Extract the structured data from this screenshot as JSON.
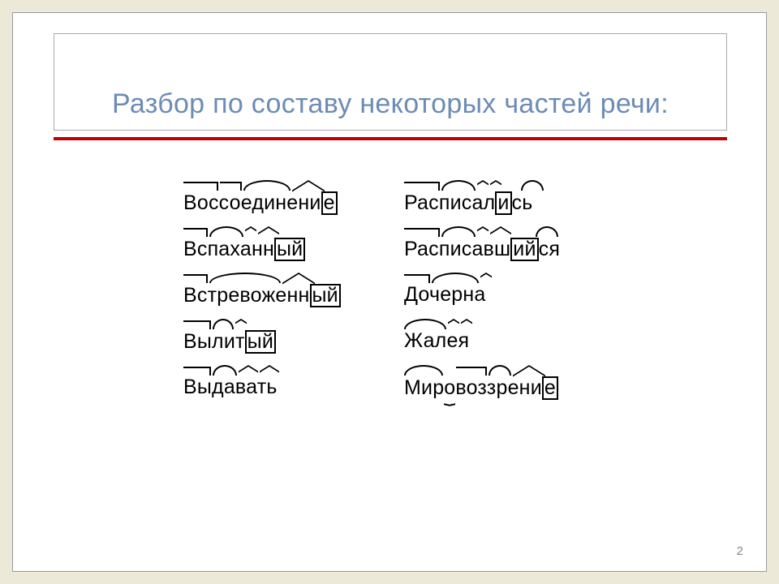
{
  "title": "Разбор по составу некоторых частей речи:",
  "page_number": "2",
  "words": [
    {
      "left": {
        "text": "Воссоединение",
        "morphemes": {
          "prefixes": [
            "Вос",
            "со"
          ],
          "roots": [
            "един"
          ],
          "suffixes": [
            "ени"
          ],
          "ending": "е"
        }
      },
      "right": {
        "text": "Расписались",
        "morphemes": {
          "prefixes": [
            "Рас"
          ],
          "roots": [
            "пис"
          ],
          "suffixes": [
            "а",
            "л"
          ],
          "ending": "и",
          "postfix": "сь"
        }
      }
    },
    {
      "left": {
        "text": "Вспаханный",
        "morphemes": {
          "prefixes": [
            "Вс"
          ],
          "roots": [
            "пах"
          ],
          "suffixes": [
            "а",
            "нн"
          ],
          "ending": "ый"
        }
      },
      "right": {
        "text": "Расписавшийся",
        "morphemes": {
          "prefixes": [
            "Рас"
          ],
          "roots": [
            "пис"
          ],
          "suffixes": [
            "а",
            "вш"
          ],
          "ending": "ий",
          "postfix": "ся"
        }
      }
    },
    {
      "left": {
        "text": "Встревоженный",
        "morphemes": {
          "prefixes": [
            "Вс"
          ],
          "roots": [
            "тревож"
          ],
          "suffixes": [
            "енн"
          ],
          "ending": "ый"
        }
      },
      "right": {
        "text": "Дочерна",
        "morphemes": {
          "prefixes": [
            "До"
          ],
          "roots": [
            "черн"
          ],
          "suffixes": [
            "а"
          ]
        }
      }
    },
    {
      "left": {
        "text": "Вылитый",
        "morphemes": {
          "prefixes": [
            "Вы"
          ],
          "roots": [
            "ли"
          ],
          "suffixes": [
            "т"
          ],
          "ending": "ый"
        }
      },
      "right": {
        "text": "Жалея",
        "morphemes": {
          "roots": [
            "Жал"
          ],
          "suffixes": [
            "е",
            "я"
          ]
        }
      }
    },
    {
      "left": {
        "text": "Выдавать",
        "morphemes": {
          "prefixes": [
            "Вы"
          ],
          "roots": [
            "да"
          ],
          "suffixes": [
            "ва",
            "ть"
          ]
        }
      },
      "right": {
        "text": "Мировоззрение",
        "morphemes": {
          "roots": [
            "Мир",
            "зр"
          ],
          "connector": "о",
          "prefixes": [
            "воз"
          ],
          "suffixes": [
            "ени"
          ],
          "ending": "е"
        }
      }
    }
  ]
}
